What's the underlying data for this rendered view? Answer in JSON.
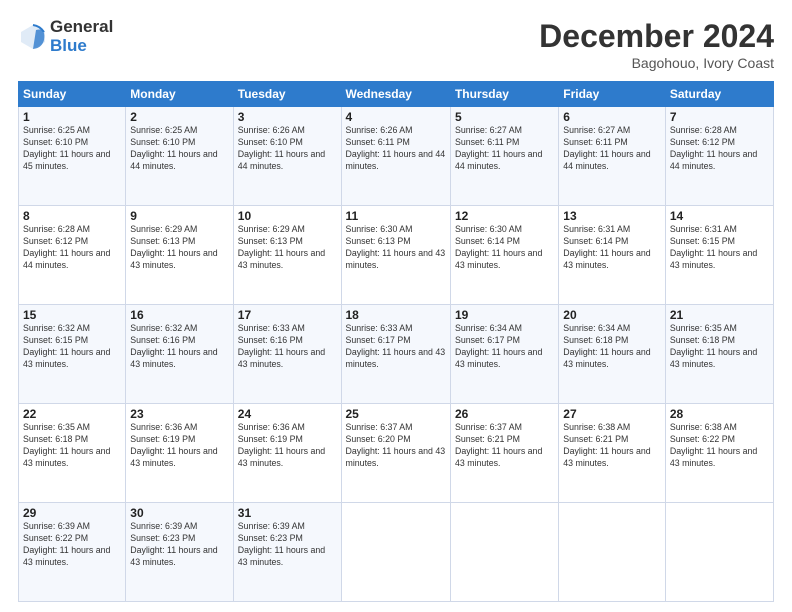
{
  "header": {
    "logo_general": "General",
    "logo_blue": "Blue",
    "month_title": "December 2024",
    "location": "Bagohouo, Ivory Coast"
  },
  "days_of_week": [
    "Sunday",
    "Monday",
    "Tuesday",
    "Wednesday",
    "Thursday",
    "Friday",
    "Saturday"
  ],
  "weeks": [
    [
      {
        "day": "1",
        "sunrise": "Sunrise: 6:25 AM",
        "sunset": "Sunset: 6:10 PM",
        "daylight": "Daylight: 11 hours and 45 minutes."
      },
      {
        "day": "2",
        "sunrise": "Sunrise: 6:25 AM",
        "sunset": "Sunset: 6:10 PM",
        "daylight": "Daylight: 11 hours and 44 minutes."
      },
      {
        "day": "3",
        "sunrise": "Sunrise: 6:26 AM",
        "sunset": "Sunset: 6:10 PM",
        "daylight": "Daylight: 11 hours and 44 minutes."
      },
      {
        "day": "4",
        "sunrise": "Sunrise: 6:26 AM",
        "sunset": "Sunset: 6:11 PM",
        "daylight": "Daylight: 11 hours and 44 minutes."
      },
      {
        "day": "5",
        "sunrise": "Sunrise: 6:27 AM",
        "sunset": "Sunset: 6:11 PM",
        "daylight": "Daylight: 11 hours and 44 minutes."
      },
      {
        "day": "6",
        "sunrise": "Sunrise: 6:27 AM",
        "sunset": "Sunset: 6:11 PM",
        "daylight": "Daylight: 11 hours and 44 minutes."
      },
      {
        "day": "7",
        "sunrise": "Sunrise: 6:28 AM",
        "sunset": "Sunset: 6:12 PM",
        "daylight": "Daylight: 11 hours and 44 minutes."
      }
    ],
    [
      {
        "day": "8",
        "sunrise": "Sunrise: 6:28 AM",
        "sunset": "Sunset: 6:12 PM",
        "daylight": "Daylight: 11 hours and 44 minutes."
      },
      {
        "day": "9",
        "sunrise": "Sunrise: 6:29 AM",
        "sunset": "Sunset: 6:13 PM",
        "daylight": "Daylight: 11 hours and 43 minutes."
      },
      {
        "day": "10",
        "sunrise": "Sunrise: 6:29 AM",
        "sunset": "Sunset: 6:13 PM",
        "daylight": "Daylight: 11 hours and 43 minutes."
      },
      {
        "day": "11",
        "sunrise": "Sunrise: 6:30 AM",
        "sunset": "Sunset: 6:13 PM",
        "daylight": "Daylight: 11 hours and 43 minutes."
      },
      {
        "day": "12",
        "sunrise": "Sunrise: 6:30 AM",
        "sunset": "Sunset: 6:14 PM",
        "daylight": "Daylight: 11 hours and 43 minutes."
      },
      {
        "day": "13",
        "sunrise": "Sunrise: 6:31 AM",
        "sunset": "Sunset: 6:14 PM",
        "daylight": "Daylight: 11 hours and 43 minutes."
      },
      {
        "day": "14",
        "sunrise": "Sunrise: 6:31 AM",
        "sunset": "Sunset: 6:15 PM",
        "daylight": "Daylight: 11 hours and 43 minutes."
      }
    ],
    [
      {
        "day": "15",
        "sunrise": "Sunrise: 6:32 AM",
        "sunset": "Sunset: 6:15 PM",
        "daylight": "Daylight: 11 hours and 43 minutes."
      },
      {
        "day": "16",
        "sunrise": "Sunrise: 6:32 AM",
        "sunset": "Sunset: 6:16 PM",
        "daylight": "Daylight: 11 hours and 43 minutes."
      },
      {
        "day": "17",
        "sunrise": "Sunrise: 6:33 AM",
        "sunset": "Sunset: 6:16 PM",
        "daylight": "Daylight: 11 hours and 43 minutes."
      },
      {
        "day": "18",
        "sunrise": "Sunrise: 6:33 AM",
        "sunset": "Sunset: 6:17 PM",
        "daylight": "Daylight: 11 hours and 43 minutes."
      },
      {
        "day": "19",
        "sunrise": "Sunrise: 6:34 AM",
        "sunset": "Sunset: 6:17 PM",
        "daylight": "Daylight: 11 hours and 43 minutes."
      },
      {
        "day": "20",
        "sunrise": "Sunrise: 6:34 AM",
        "sunset": "Sunset: 6:18 PM",
        "daylight": "Daylight: 11 hours and 43 minutes."
      },
      {
        "day": "21",
        "sunrise": "Sunrise: 6:35 AM",
        "sunset": "Sunset: 6:18 PM",
        "daylight": "Daylight: 11 hours and 43 minutes."
      }
    ],
    [
      {
        "day": "22",
        "sunrise": "Sunrise: 6:35 AM",
        "sunset": "Sunset: 6:18 PM",
        "daylight": "Daylight: 11 hours and 43 minutes."
      },
      {
        "day": "23",
        "sunrise": "Sunrise: 6:36 AM",
        "sunset": "Sunset: 6:19 PM",
        "daylight": "Daylight: 11 hours and 43 minutes."
      },
      {
        "day": "24",
        "sunrise": "Sunrise: 6:36 AM",
        "sunset": "Sunset: 6:19 PM",
        "daylight": "Daylight: 11 hours and 43 minutes."
      },
      {
        "day": "25",
        "sunrise": "Sunrise: 6:37 AM",
        "sunset": "Sunset: 6:20 PM",
        "daylight": "Daylight: 11 hours and 43 minutes."
      },
      {
        "day": "26",
        "sunrise": "Sunrise: 6:37 AM",
        "sunset": "Sunset: 6:21 PM",
        "daylight": "Daylight: 11 hours and 43 minutes."
      },
      {
        "day": "27",
        "sunrise": "Sunrise: 6:38 AM",
        "sunset": "Sunset: 6:21 PM",
        "daylight": "Daylight: 11 hours and 43 minutes."
      },
      {
        "day": "28",
        "sunrise": "Sunrise: 6:38 AM",
        "sunset": "Sunset: 6:22 PM",
        "daylight": "Daylight: 11 hours and 43 minutes."
      }
    ],
    [
      {
        "day": "29",
        "sunrise": "Sunrise: 6:39 AM",
        "sunset": "Sunset: 6:22 PM",
        "daylight": "Daylight: 11 hours and 43 minutes."
      },
      {
        "day": "30",
        "sunrise": "Sunrise: 6:39 AM",
        "sunset": "Sunset: 6:23 PM",
        "daylight": "Daylight: 11 hours and 43 minutes."
      },
      {
        "day": "31",
        "sunrise": "Sunrise: 6:39 AM",
        "sunset": "Sunset: 6:23 PM",
        "daylight": "Daylight: 11 hours and 43 minutes."
      },
      null,
      null,
      null,
      null
    ]
  ]
}
